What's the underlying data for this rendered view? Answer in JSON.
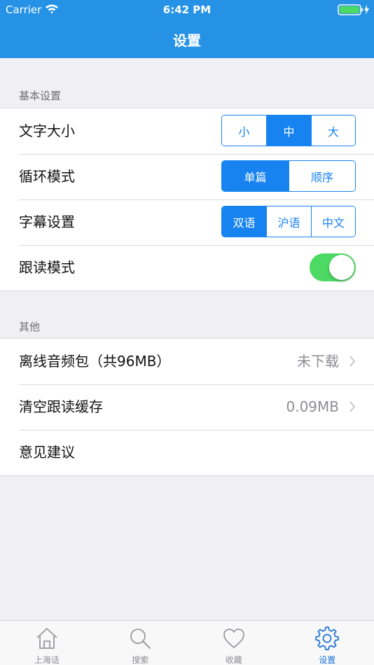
{
  "status_bar": {
    "carrier": "Carrier",
    "time": "6:42 PM"
  },
  "nav": {
    "title": "设置"
  },
  "sections": {
    "basic": {
      "label": "基本设置",
      "font_size": {
        "label": "文字大小",
        "options": [
          "小",
          "中",
          "大"
        ],
        "selected": "中"
      },
      "loop_mode": {
        "label": "循环模式",
        "options": [
          "单篇",
          "顺序"
        ],
        "selected": "单篇"
      },
      "subtitle": {
        "label": "字幕设置",
        "options": [
          "双语",
          "沪语",
          "中文"
        ],
        "selected": "双语"
      },
      "follow_read": {
        "label": "跟读模式",
        "enabled": true
      }
    },
    "other": {
      "label": "其他",
      "offline_pack": {
        "label": "离线音频包（共96MB）",
        "value": "未下载"
      },
      "clear_cache": {
        "label": "清空跟读缓存",
        "value": "0.09MB"
      },
      "feedback": {
        "label": "意见建议"
      }
    }
  },
  "tabbar": {
    "tabs": [
      {
        "label": "上海话",
        "icon": "home-icon"
      },
      {
        "label": "搜索",
        "icon": "search-icon"
      },
      {
        "label": "收藏",
        "icon": "heart-icon"
      },
      {
        "label": "设置",
        "icon": "gear-icon",
        "active": true
      }
    ]
  },
  "colors": {
    "header": "#2592e6",
    "accent": "#1683f0",
    "toggle_on": "#4cd964",
    "tab_active": "#1a70d8"
  }
}
